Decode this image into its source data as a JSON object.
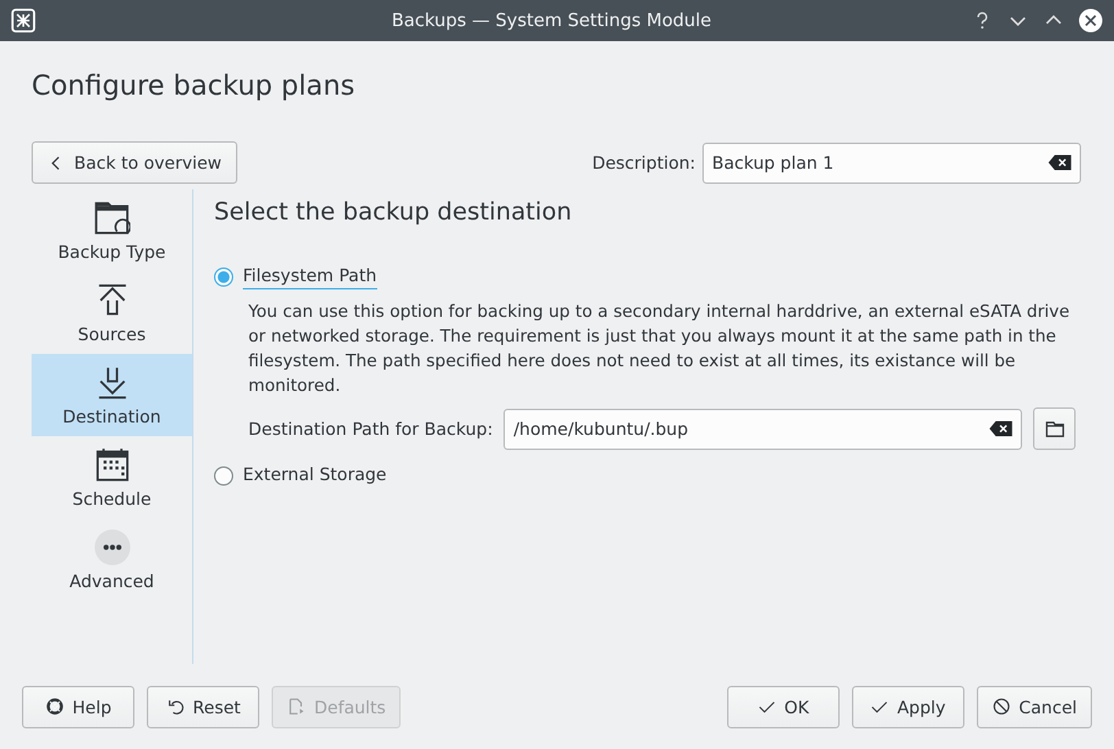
{
  "window": {
    "title": "Backups — System Settings Module"
  },
  "heading": "Configure backup plans",
  "back_button": "Back to overview",
  "description": {
    "label": "Description:",
    "value": "Backup plan 1"
  },
  "sidebar": {
    "items": [
      {
        "label": "Backup Type",
        "selected": false
      },
      {
        "label": "Sources",
        "selected": false
      },
      {
        "label": "Destination",
        "selected": true
      },
      {
        "label": "Schedule",
        "selected": false
      },
      {
        "label": "Advanced",
        "selected": false
      }
    ]
  },
  "page_title": "Select the backup destination",
  "options": [
    {
      "label": "Filesystem Path",
      "selected": true,
      "description": "You can use this option for backing up to a secondary internal harddrive, an external eSATA drive or networked storage. The requirement is just that you always mount it at the same path in the filesystem. The path specified here does not need to exist at all times, its existance will be monitored.",
      "path_label": "Destination Path for Backup:",
      "path_value": "/home/kubuntu/.bup"
    },
    {
      "label": "External Storage",
      "selected": false
    }
  ],
  "footer_left": [
    {
      "label": "Help",
      "disabled": false
    },
    {
      "label": "Reset",
      "disabled": false
    },
    {
      "label": "Defaults",
      "disabled": true
    }
  ],
  "footer_right": [
    {
      "label": "OK",
      "disabled": false
    },
    {
      "label": "Apply",
      "disabled": false
    },
    {
      "label": "Cancel",
      "disabled": false
    }
  ]
}
